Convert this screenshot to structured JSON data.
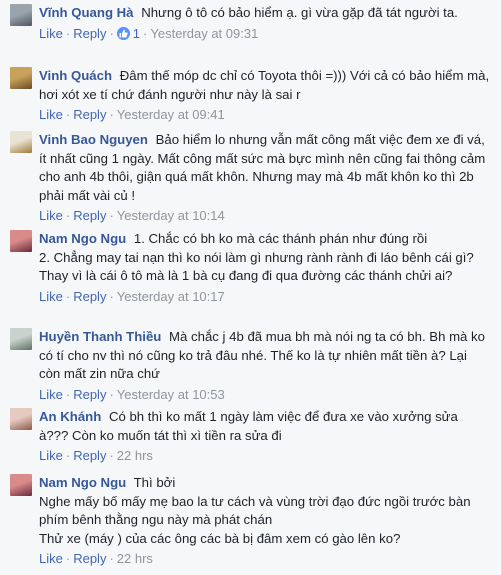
{
  "actions": {
    "like": "Like",
    "reply": "Reply",
    "separator": "·"
  },
  "comments": [
    {
      "author": "Vĩnh Quang Hà",
      "text": "Nhưng ô tô có bảo hiểm ạ.      gì vừa gặp đã tát người ta.",
      "likes": "1",
      "time": "Yesterday at 09:31",
      "avatar_colors": [
        "#9aa4ad",
        "#4d5560"
      ]
    },
    {
      "author": "Vinh Quách",
      "text": "Đâm thế móp dc chỉ có Toyota thôi =))) Với cả có bảo hiểm mà, hơi xót xe tí chứ đánh người như này là sai r",
      "time": "Yesterday at 09:41",
      "avatar_colors": [
        "#c8a15a",
        "#6b4a2a"
      ]
    },
    {
      "author": "Vinh Bao Nguyen",
      "text": "Bảo hiểm lo nhưng vẫn mất công mất việc đem xe đi vá, ít nhất cũng 1 ngày. Mất công mất sức mà bực mình nên cũng fai thông cảm cho anh 4b thôi, giận quá mất khôn. Nhưng may mà 4b mất khôn ko thì 2b phải mất vài củ !",
      "time": "Yesterday at 10:14",
      "avatar_colors": [
        "#e9e3d6",
        "#a07a3a"
      ]
    },
    {
      "author": "Nam Ngo Ngu",
      "lines": [
        "1. Chắc có bh ko mà các thánh phán như đúng rồi",
        "2. Chẳng may tai nạn thì ko nói làm gì nhưng rành rành đi láo bênh cái gì? Thay vì là cái ô tô mà là 1 bà cụ đang đi qua đường các thánh chửi ai?"
      ],
      "time": "Yesterday at 10:17",
      "avatar_colors": [
        "#d98a8a",
        "#6a2a3a"
      ]
    },
    {
      "author": "Huyền Thanh Thiều",
      "text": "Mà chắc j 4b đã mua bh mà nói ng ta có bh. Bh mà ko có tí cho nv thì nó cũng ko trả đâu nhé. Thế ko là tự nhiên mất tiền à? Lại còn mất zin nữa chứ",
      "time": "Yesterday at 10:53",
      "avatar_colors": [
        "#c9d2cc",
        "#5d6f63"
      ]
    },
    {
      "author": "An Khánh",
      "text": "Có bh thì ko mất 1 ngày làm việc để đưa xe vào xưởng sửa à??? Còn ko muốn tát thì xì tiền ra sửa đi",
      "time": "22 hrs",
      "avatar_colors": [
        "#e6c9c0",
        "#8a5a4a"
      ]
    },
    {
      "author": "Nam Ngo Ngu",
      "lines": [
        "Thì bởi",
        "Nghe mấy bố mấy mẹ bao la tư cách và vùng trời đạo đức ngồi trước bàn phím bênh thằng ngu này mà phát chán",
        "Thử xe (máy ) của các ông các bà bị đâm xem có gào lên ko?"
      ],
      "time": "22 hrs",
      "avatar_colors": [
        "#d98a8a",
        "#6a2a3a"
      ]
    }
  ]
}
